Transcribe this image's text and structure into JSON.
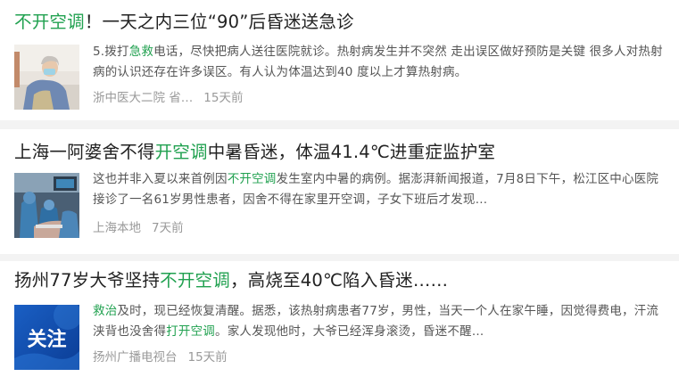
{
  "articles": [
    {
      "title_parts": [
        {
          "text": "不开空调",
          "hl": true
        },
        {
          "text": "！一天之内三位“90”后昏迷送急诊",
          "hl": false
        }
      ],
      "snippet_parts": [
        {
          "text": "5.拨打",
          "hl": false
        },
        {
          "text": "急救",
          "hl": true
        },
        {
          "text": "电话，尽快把病人送往医院就诊。热射病发生并不突然 走出误区做好预防是关键 很多人对热射病的认识还存在许多误区。有人认为体温达到40 度以上才算热射病。",
          "hl": false
        }
      ],
      "source": "浙中医大二院 省…",
      "time": "15天前",
      "thumb_icon": "patient-photo"
    },
    {
      "title_parts": [
        {
          "text": "上海一阿婆舍不得",
          "hl": false
        },
        {
          "text": "开空调",
          "hl": true
        },
        {
          "text": "中暑昏迷，体温41.4℃进重症监护室",
          "hl": false
        }
      ],
      "snippet_parts": [
        {
          "text": "这也并非入夏以来首例因",
          "hl": false
        },
        {
          "text": "不开空调",
          "hl": true
        },
        {
          "text": "发生室内中暑的病例。据澎湃新闻报道，7月8日下午，松江区中心医院接诊了一名61岁男性患者，因舍不得在家里开空调，子女下班后才发现…",
          "hl": false
        }
      ],
      "source": "上海本地",
      "time": "7天前",
      "thumb_icon": "hospital-photo"
    },
    {
      "title_parts": [
        {
          "text": "扬州77岁大爷坚持",
          "hl": false
        },
        {
          "text": "不开空调",
          "hl": true
        },
        {
          "text": "，高烧至40℃陷入昏迷……",
          "hl": false
        }
      ],
      "snippet_parts": [
        {
          "text": "救治",
          "hl": true
        },
        {
          "text": "及时，现已经恢复清醒。据悉，该热射病患者77岁，男性，当天一个人在家午睡，因觉得费电，汗流浃背也没舍得",
          "hl": false
        },
        {
          "text": "打开空调",
          "hl": true
        },
        {
          "text": "。家人发现他时，大爷已经浑身滚烫，昏迷不醒…",
          "hl": false
        }
      ],
      "source": "扬州广播电视台",
      "time": "15天前",
      "thumb_icon": "guanzhu-badge",
      "thumb_text": "关注"
    }
  ]
}
